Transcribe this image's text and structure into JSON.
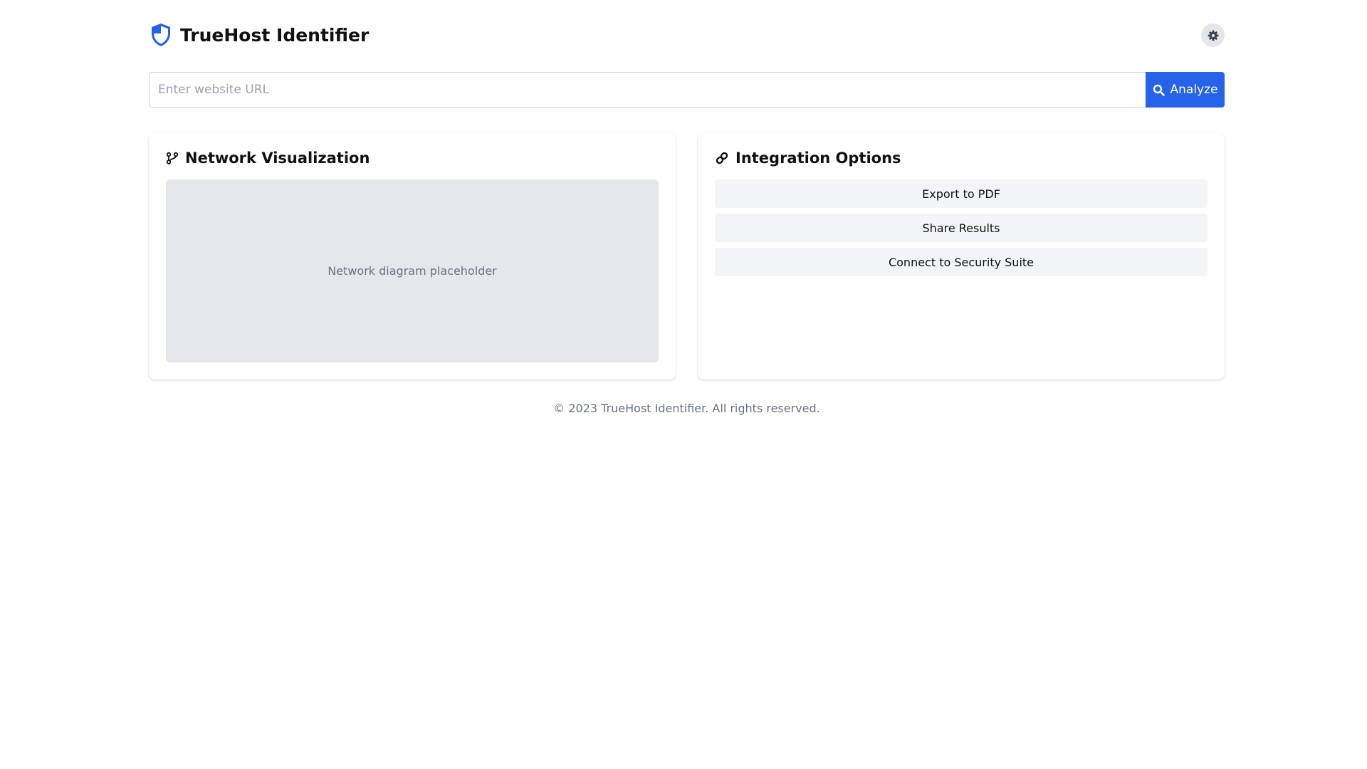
{
  "app": {
    "title": "TrueHost Identifier"
  },
  "header": {
    "logo_icon": "shield-icon",
    "settings_icon": "gear-icon"
  },
  "search": {
    "value": "",
    "placeholder": "Enter website URL",
    "button_label": "Analyze",
    "button_icon": "search-icon"
  },
  "network": {
    "title": "Network Visualization",
    "icon": "branch-icon",
    "placeholder_text": "Network diagram placeholder"
  },
  "integration": {
    "title": "Integration Options",
    "icon": "link-icon",
    "options": [
      {
        "label": "Export to PDF"
      },
      {
        "label": "Share Results"
      },
      {
        "label": "Connect to Security Suite"
      }
    ]
  },
  "footer": {
    "text": "© 2023 TrueHost Identifier. All rights reserved."
  },
  "colors": {
    "accent": "#2563eb",
    "placeholder_bg": "#e5e7eb",
    "option_bg": "#f3f4f6",
    "muted_text": "#6b7280"
  }
}
